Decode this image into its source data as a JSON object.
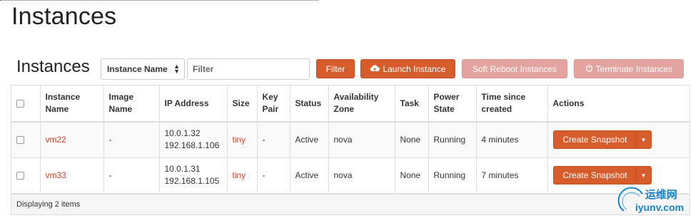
{
  "page": {
    "title": "Instances"
  },
  "toolbar": {
    "section_title": "Instances",
    "filter_field": "Instance Name",
    "filter_placeholder": "Filter",
    "filter_button": "Filter",
    "launch_button": "Launch Instance",
    "soft_reboot_button": "Soft Reboot Instances",
    "terminate_button": "Terminate Instances"
  },
  "table": {
    "headers": {
      "instance_name": "Instance Name",
      "image_name": "Image Name",
      "ip_address": "IP Address",
      "size": "Size",
      "key_pair": "Key Pair",
      "status": "Status",
      "availability_zone": "Availability Zone",
      "task": "Task",
      "power_state": "Power State",
      "time_since_created": "Time since created",
      "actions": "Actions"
    },
    "rows": [
      {
        "name": "vm22",
        "image": "-",
        "ip_1": "10.0.1.32",
        "ip_2": "192.168.1.106",
        "size": "tiny",
        "key_pair": "-",
        "status": "Active",
        "zone": "nova",
        "task": "None",
        "power": "Running",
        "age": "4 minutes",
        "action": "Create Snapshot"
      },
      {
        "name": "vm33",
        "image": "-",
        "ip_1": "10.0.1.31",
        "ip_2": "192.168.1.105",
        "size": "tiny",
        "key_pair": "-",
        "status": "Active",
        "zone": "nova",
        "task": "None",
        "power": "Running",
        "age": "7 minutes",
        "action": "Create Snapshot"
      }
    ],
    "footer": "Displaying 2 items"
  },
  "watermark": {
    "cn": "运维网",
    "en": "iyunv.com"
  },
  "colors": {
    "primary": "#d65c2c",
    "disabled": "#e3a3a0",
    "link": "#c9432a",
    "watermark": "#1a84c9"
  },
  "icons": [
    "cloud-upload-icon",
    "power-icon",
    "caret-down-icon",
    "sort-caret-icon"
  ]
}
